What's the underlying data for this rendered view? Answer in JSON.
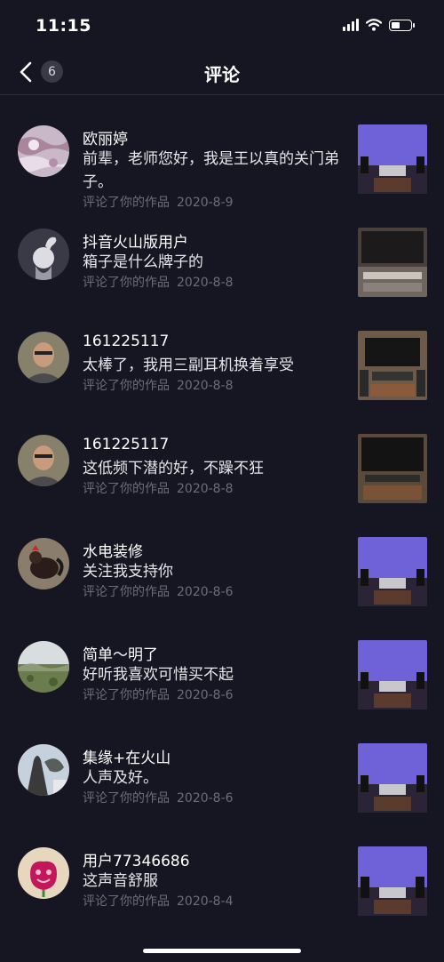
{
  "status_bar": {
    "time": "11:15"
  },
  "nav": {
    "title": "评论",
    "badge_count": "6"
  },
  "meta_label": "评论了你的作品",
  "comments": [
    {
      "name": "欧丽婷",
      "text": "前辈，老师您好，我是王以真的关门弟子。",
      "date": "2020-8-9",
      "avatar": "lace-photo",
      "thumb": "purple-studio"
    },
    {
      "name": "抖音火山版用户",
      "text": "箱子是什么牌子的",
      "date": "2020-8-8",
      "avatar": "default-avatar",
      "thumb": "blurred-equipment"
    },
    {
      "name": "161225117",
      "text": "太棒了，我用三副耳机换着享受",
      "date": "2020-8-8",
      "avatar": "man-portrait",
      "thumb": "tv-rack"
    },
    {
      "name": "161225117",
      "text": "这低频下潜的好，不躁不狂",
      "date": "2020-8-8",
      "avatar": "man-portrait",
      "thumb": "tv-rack"
    },
    {
      "name": "水电装修",
      "text": "关注我支持你",
      "date": "2020-8-6",
      "avatar": "rooster-photo",
      "thumb": "purple-studio"
    },
    {
      "name": "简单～明了",
      "text": "好听我喜欢可惜买不起",
      "date": "2020-8-6",
      "avatar": "landscape-photo",
      "thumb": "purple-studio"
    },
    {
      "name": "集缘+在火山",
      "text": "人声及好。",
      "date": "2020-8-6",
      "avatar": "tree-photo",
      "thumb": "purple-studio"
    },
    {
      "name": "用户77346686",
      "text": "这声音舒服",
      "date": "2020-8-4",
      "avatar": "pink-flower-avatar",
      "thumb": "purple-studio"
    }
  ]
}
